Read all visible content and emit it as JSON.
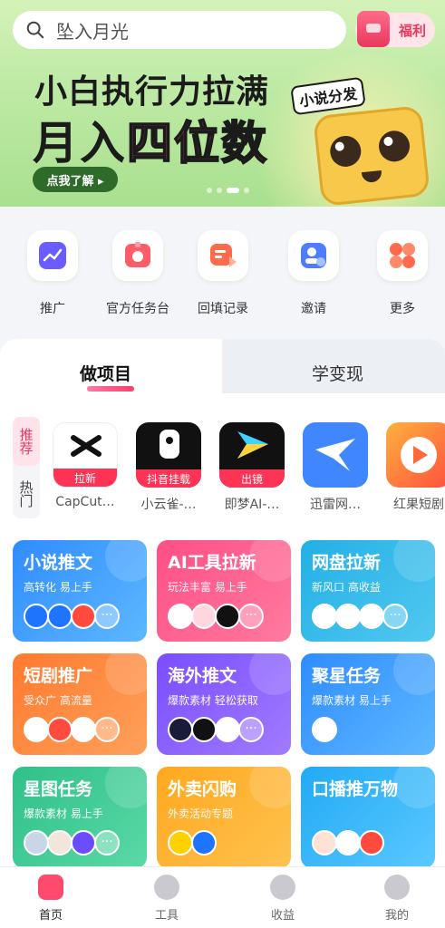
{
  "search": {
    "placeholder": "坠入月光"
  },
  "header": {
    "welfare_label": "福利"
  },
  "banner": {
    "line1": "小白执行力拉满",
    "line2_a": "月入",
    "line2_b": "四位数",
    "tag": "小说分发",
    "cta": "点我了解 ▸"
  },
  "quick": [
    {
      "label": "推广"
    },
    {
      "label": "官方任务台"
    },
    {
      "label": "回填记录"
    },
    {
      "label": "邀请"
    },
    {
      "label": "更多"
    }
  ],
  "tabs": {
    "active": "做项目",
    "inactive": "学变现"
  },
  "side": {
    "recommend": "推荐",
    "hot": "热门"
  },
  "apps": [
    {
      "name": "CapCut…",
      "badge": "拉新",
      "color": "#ffffff"
    },
    {
      "name": "小云雀-…",
      "badge": "抖音挂载",
      "color": "#111111"
    },
    {
      "name": "即梦AI-…",
      "badge": "出镜",
      "color": "#111111"
    },
    {
      "name": "迅雷网…",
      "badge": "",
      "color": "#3f86ff"
    },
    {
      "name": "红果短剧",
      "badge": "",
      "color": "#ff6a3d"
    }
  ],
  "cards": [
    {
      "title": "小说推文",
      "desc": "高转化 易上手",
      "color": "#3f9cff"
    },
    {
      "title": "AI工具拉新",
      "desc": "玩法丰富 易上手",
      "color": "#ff4f86"
    },
    {
      "title": "网盘拉新",
      "desc": "新风口 高收益",
      "color": "#33b8e0"
    },
    {
      "title": "短剧推广",
      "desc": "受众广 高流量",
      "color": "#ff8a3d"
    },
    {
      "title": "海外推文",
      "desc": "爆款素材 轻松获取",
      "color": "#8a5cff"
    },
    {
      "title": "聚星任务",
      "desc": "爆款素材 易上手",
      "color": "#3aa6ff"
    },
    {
      "title": "星图任务",
      "desc": "爆款素材 易上手",
      "color": "#3cc98a"
    },
    {
      "title": "外卖闪购",
      "desc": "外卖活动专题",
      "color": "#ffb020"
    },
    {
      "title": "口播推万物",
      "desc": "",
      "color": "#2fb6ff"
    }
  ],
  "nav": [
    {
      "label": "首页"
    },
    {
      "label": "工具"
    },
    {
      "label": "收益"
    },
    {
      "label": "我的"
    }
  ]
}
